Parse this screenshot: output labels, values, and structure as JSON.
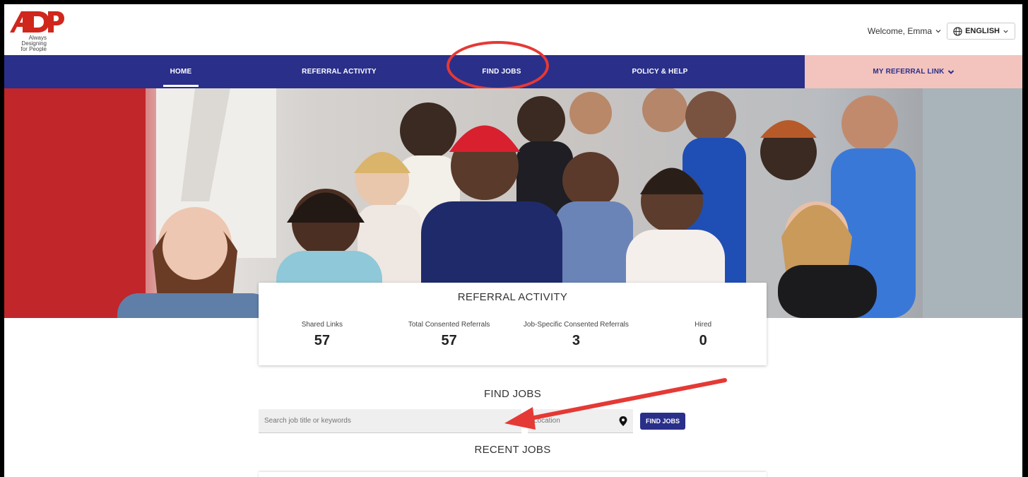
{
  "header": {
    "logo_text": "ADP",
    "logo_tagline_1": "Always Designing",
    "logo_tagline_2": "for People",
    "welcome": "Welcome, Emma",
    "language": "ENGLISH"
  },
  "nav": {
    "items": [
      {
        "label": "HOME"
      },
      {
        "label": "REFERRAL ACTIVITY"
      },
      {
        "label": "FIND JOBS"
      },
      {
        "label": "POLICY & HELP"
      },
      {
        "label": "MY REFERRAL LINK"
      }
    ]
  },
  "referral": {
    "title": "REFERRAL ACTIVITY",
    "stats": [
      {
        "label": "Shared Links",
        "value": "57"
      },
      {
        "label": "Total Consented Referrals",
        "value": "57"
      },
      {
        "label": "Job-Specific Consented Referrals",
        "value": "3"
      },
      {
        "label": "Hired",
        "value": "0"
      }
    ]
  },
  "find_jobs": {
    "title": "FIND JOBS",
    "search_placeholder": "Search job title or keywords",
    "location_placeholder": "Location",
    "button": "FIND JOBS"
  },
  "recent": {
    "title": "RECENT JOBS"
  },
  "colors": {
    "nav_bg": "#2a2f8a",
    "referral_link_bg": "#f3c3be",
    "annotation": "#e53935",
    "brand_red": "#d0271d"
  }
}
